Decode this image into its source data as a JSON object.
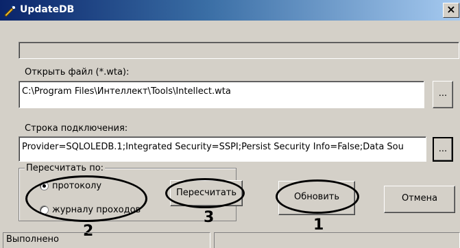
{
  "window": {
    "title": "UpdateDB",
    "close_label": "×"
  },
  "file": {
    "label": "Открыть файл (*.wta):",
    "value": "C:\\Program Files\\Интеллект\\Tools\\Intellect.wta",
    "browse_label": "..."
  },
  "connection": {
    "label": "Строка подключения:",
    "value": "Provider=SQLOLEDB.1;Integrated Security=SSPI;Persist Security Info=False;Data Sou",
    "browse_label": "..."
  },
  "recalc_group": {
    "legend": "Пересчитать по:",
    "options": [
      {
        "label": "протоколу",
        "selected": true
      },
      {
        "label": "журналу проходов",
        "selected": false
      }
    ]
  },
  "buttons": {
    "recalc": "Пересчитать",
    "update": "Обновить",
    "cancel": "Отмена"
  },
  "annotations": [
    "1",
    "2",
    "3"
  ],
  "status": {
    "left": "Выполнено",
    "right": ""
  },
  "colors": {
    "dialog_bg": "#d4d0c8",
    "title_start": "#0a246a",
    "title_end": "#a6caf0",
    "annotation": "#000000"
  }
}
